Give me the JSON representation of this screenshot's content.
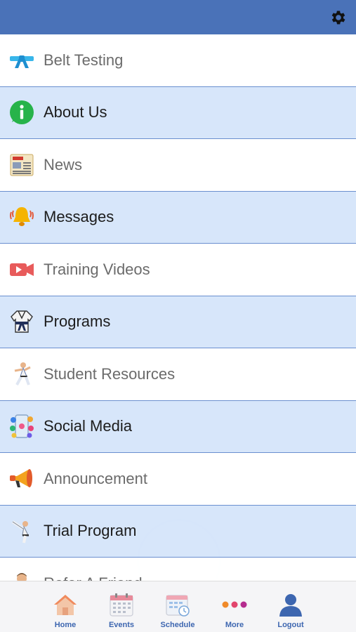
{
  "header": {
    "settings_icon": "gear-icon"
  },
  "menu": {
    "items": [
      {
        "label": "Belt Testing",
        "icon": "belt-icon"
      },
      {
        "label": "About Us",
        "icon": "info-icon"
      },
      {
        "label": "News",
        "icon": "newspaper-icon"
      },
      {
        "label": "Messages",
        "icon": "bell-icon"
      },
      {
        "label": "Training Videos",
        "icon": "video-icon"
      },
      {
        "label": "Programs",
        "icon": "uniform-icon"
      },
      {
        "label": "Student Resources",
        "icon": "martial-artist-icon"
      },
      {
        "label": "Social Media",
        "icon": "social-phone-icon"
      },
      {
        "label": "Announcement",
        "icon": "megaphone-icon"
      },
      {
        "label": "Trial Program",
        "icon": "kick-icon"
      },
      {
        "label": "Refer A Friend",
        "icon": "person-icon"
      }
    ]
  },
  "tabbar": {
    "home": "Home",
    "events": "Events",
    "schedule": "Schedule",
    "more": "More",
    "logout": "Logout"
  },
  "colors": {
    "header": "#4a72b8",
    "row_alt": "#d4e4fa",
    "tab_label": "#3d66b0"
  }
}
